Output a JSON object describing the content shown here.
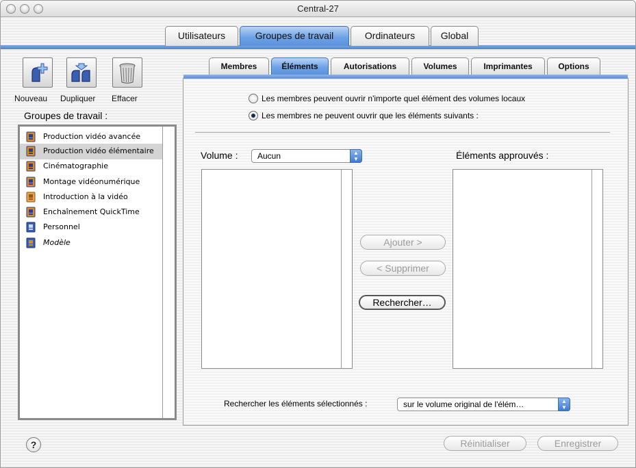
{
  "window": {
    "title": "Central-27"
  },
  "main_tabs": [
    {
      "label": "Utilisateurs"
    },
    {
      "label": "Groupes de travail",
      "active": true
    },
    {
      "label": "Ordinateurs"
    },
    {
      "label": "Global"
    }
  ],
  "toolbar": {
    "new_label": "Nouveau",
    "duplicate_label": "Dupliquer",
    "delete_label": "Effacer"
  },
  "groups": {
    "heading": "Groupes de travail :",
    "items": [
      {
        "label": "Production vidéo avancée"
      },
      {
        "label": "Production vidéo élémentaire",
        "selected": true
      },
      {
        "label": "Cinématographie"
      },
      {
        "label": "Montage vidéonumérique"
      },
      {
        "label": "Introduction à la vidéo"
      },
      {
        "label": "Enchaînement QuickTime"
      },
      {
        "label": "Personnel"
      },
      {
        "label": "Modèle"
      }
    ]
  },
  "sub_tabs": [
    {
      "label": "Membres"
    },
    {
      "label": "Éléments",
      "active": true
    },
    {
      "label": "Autorisations"
    },
    {
      "label": "Volumes"
    },
    {
      "label": "Imprimantes"
    },
    {
      "label": "Options"
    }
  ],
  "elements": {
    "radio_any": "Les membres peuvent ouvrir n'importe quel élément des volumes locaux",
    "radio_only": "Les membres ne peuvent ouvrir que les éléments suivants :",
    "volume_label": "Volume :",
    "volume_value": "Aucun",
    "approved_label": "Éléments approuvés :",
    "add_button": "Ajouter >",
    "remove_button": "< Supprimer",
    "search_button": "Rechercher…",
    "search_selected_label": "Rechercher les éléments sélectionnés :",
    "search_selected_value": "sur le volume original de l'élém…"
  },
  "footer": {
    "reset_button": "Réinitialiser",
    "save_button": "Enregistrer",
    "help_glyph": "?"
  },
  "colors": {
    "accent_blue": "#5a92dc",
    "icon_orange": "#d98a2b",
    "icon_blue": "#3a5fb0"
  }
}
